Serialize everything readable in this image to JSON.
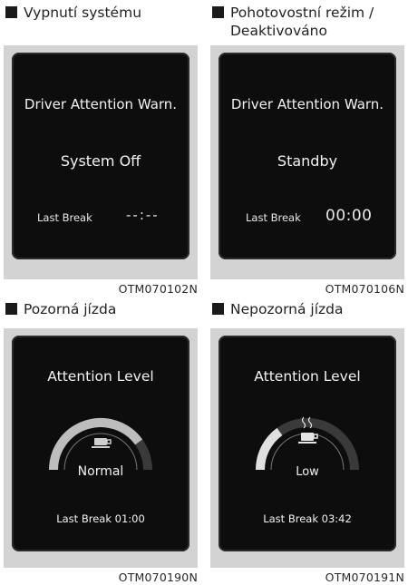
{
  "panels": [
    {
      "heading": "Vypnutí systému",
      "title": "Driver Attention Warn.",
      "status": "System Off",
      "last_break_label": "Last Break",
      "last_break_value": "--:--",
      "code": "OTM070102N"
    },
    {
      "heading": "Pohotovostní režim /\nDeaktivováno",
      "title": "Driver Attention Warn.",
      "status": "Standby",
      "last_break_label": "Last Break",
      "last_break_value": "00:00",
      "code": "OTM070106N"
    },
    {
      "heading": "Pozorná jízda",
      "title": "Attention Level",
      "level": "Normal",
      "gauge_fill": 0.8,
      "last_break": "Last Break 01:00",
      "code": "OTM070190N"
    },
    {
      "heading": "Nepozorná jízda",
      "title": "Attention Level",
      "level": "Low",
      "gauge_fill": 0.3,
      "last_break": "Last Break 03:42",
      "code": "OTM070191N"
    }
  ],
  "icons": {
    "panel_3": "coffee-cup-icon",
    "panel_4": "steaming-coffee-cup-icon"
  }
}
